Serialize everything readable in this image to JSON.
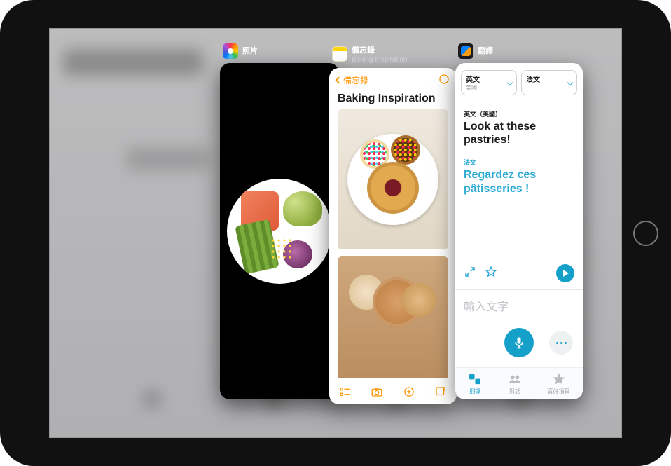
{
  "apps": {
    "photos": {
      "label": "照片"
    },
    "notes": {
      "label": "備忘錄",
      "subtitle": "Baking Inspiration"
    },
    "translate": {
      "label": "翻譯"
    }
  },
  "notes": {
    "back_label": "備忘錄",
    "title": "Baking Inspiration",
    "toolbar": {
      "checklist": "checklist-icon",
      "camera": "camera-icon",
      "markup": "markup-icon",
      "compose": "compose-icon"
    }
  },
  "translate": {
    "source": {
      "lang_label": "英文",
      "region": "美國",
      "full_label": "英文（美國）"
    },
    "target": {
      "lang_label": "法文",
      "region": ""
    },
    "source_text": "Look at these pastries!",
    "target_text": "Regardez ces pâtisseries !",
    "input_placeholder": "輸入文字",
    "tabs": {
      "translate": "翻譯",
      "conversation": "對話",
      "favorites": "喜好項目"
    }
  },
  "colors": {
    "accent_teal": "#14a0c8",
    "notes_orange": "#ff9500"
  }
}
